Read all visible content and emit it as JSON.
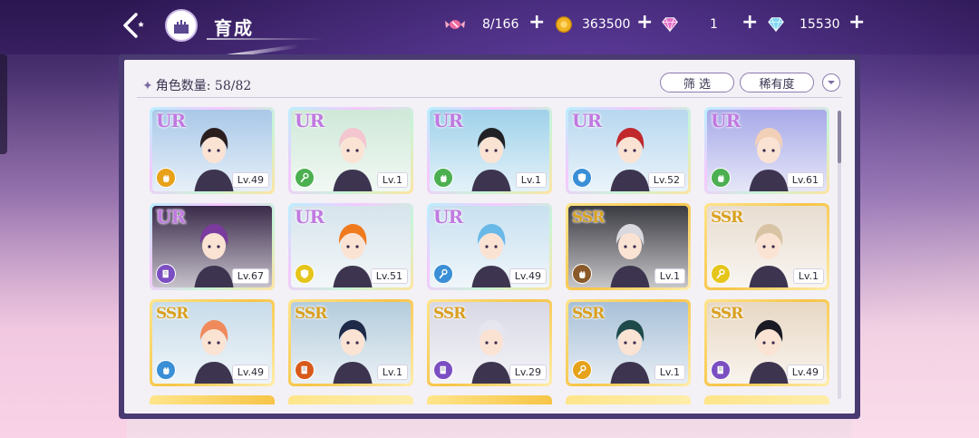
{
  "header": {
    "title": "育成",
    "resources": [
      {
        "icon": "candy-icon",
        "value": "8/166"
      },
      {
        "icon": "gold-coin-icon",
        "value": "363500"
      },
      {
        "icon": "pink-gem-icon",
        "value": "1"
      },
      {
        "icon": "blue-diamond-icon",
        "value": "15530"
      }
    ]
  },
  "panel": {
    "count_label": "角色数量:",
    "count_value": "58/82",
    "filter_label": "筛 选",
    "rarity_label": "稀有度"
  },
  "colors": {
    "panel_frame": "#4a3a72",
    "panel_bg": "#f3f1f6",
    "ur_color": "#c07ae0",
    "ssr_color": "#d9a020"
  },
  "cards": [
    {
      "rarity": "UR",
      "level": "Lv.49",
      "role_icon": "fist-icon",
      "role_color": "#e8a21a",
      "hair": "#2a1e1e",
      "bg": "#a9c8e8"
    },
    {
      "rarity": "UR",
      "level": "Lv.1",
      "role_icon": "wrench-icon",
      "role_color": "#4caf50",
      "hair": "#f4c6d0",
      "bg": "#cfe8d8"
    },
    {
      "rarity": "UR",
      "level": "Lv.1",
      "role_icon": "fist-icon",
      "role_color": "#4caf50",
      "hair": "#222226",
      "bg": "#9fd1ea"
    },
    {
      "rarity": "UR",
      "level": "Lv.52",
      "role_icon": "shield-icon",
      "role_color": "#3a8fd6",
      "hair": "#c0282c",
      "bg": "#b7d7ef"
    },
    {
      "rarity": "UR",
      "level": "Lv.61",
      "role_icon": "fist-icon",
      "role_color": "#4caf50",
      "hair": "#f2d0b8",
      "bg": "#a7a9e8"
    },
    {
      "rarity": "UR",
      "level": "Lv.67",
      "role_icon": "book-icon",
      "role_color": "#7b4fc2",
      "hair": "#7a3a9e",
      "bg": "#3a2a4a"
    },
    {
      "rarity": "UR",
      "level": "Lv.51",
      "role_icon": "shield-icon",
      "role_color": "#e5c51a",
      "hair": "#f07a1e",
      "bg": "#d6e4ec"
    },
    {
      "rarity": "UR",
      "level": "Lv.49",
      "role_icon": "wrench-icon",
      "role_color": "#3a8fd6",
      "hair": "#68b8e8",
      "bg": "#c8e0f0"
    },
    {
      "rarity": "SSR",
      "level": "Lv.1",
      "role_icon": "fist-icon",
      "role_color": "#8a5a2a",
      "hair": "#d9d9df",
      "bg": "#3a3a42"
    },
    {
      "rarity": "SSR",
      "level": "Lv.1",
      "role_icon": "wrench-icon",
      "role_color": "#e5c51a",
      "hair": "#d8c4a4",
      "bg": "#e8ddd0"
    },
    {
      "rarity": "SSR",
      "level": "Lv.49",
      "role_icon": "fist-icon",
      "role_color": "#3a8fd6",
      "hair": "#f08a5c",
      "bg": "#c8dcea"
    },
    {
      "rarity": "SSR",
      "level": "Lv.1",
      "role_icon": "book-icon",
      "role_color": "#d85a1a",
      "hair": "#1e2a48",
      "bg": "#b4ccdc"
    },
    {
      "rarity": "SSR",
      "level": "Lv.29",
      "role_icon": "book-icon",
      "role_color": "#7b4fc2",
      "hair": "#e6e6ee",
      "bg": "#d8d8e6"
    },
    {
      "rarity": "SSR",
      "level": "Lv.1",
      "role_icon": "wrench-icon",
      "role_color": "#e5a21a",
      "hair": "#1e4a4a",
      "bg": "#a8c0d8"
    },
    {
      "rarity": "SSR",
      "level": "Lv.49",
      "role_icon": "book-icon",
      "role_color": "#7b4fc2",
      "hair": "#1a1a24",
      "bg": "#e8d8c4"
    }
  ]
}
